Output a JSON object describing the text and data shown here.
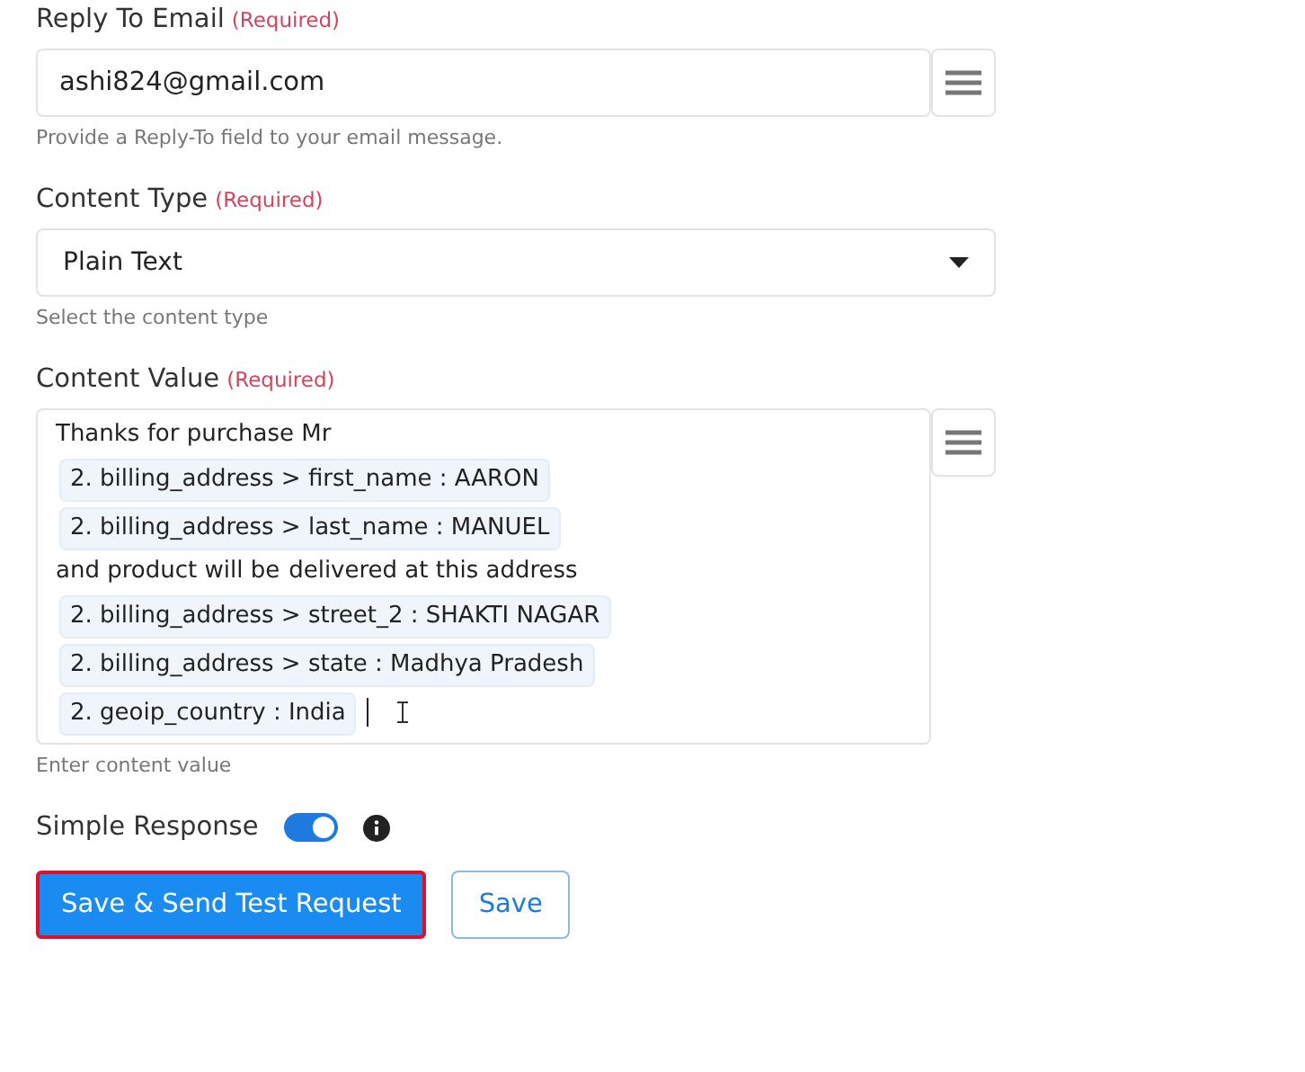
{
  "reply_to_email": {
    "label": "Reply To Email",
    "required": "(Required)",
    "value": "ashi824@gmail.com",
    "help": "Provide a Reply-To field to your email message."
  },
  "content_type": {
    "label": "Content Type",
    "required": "(Required)",
    "value": "Plain Text",
    "help": "Select the content type"
  },
  "content_value": {
    "label": "Content Value",
    "required": "(Required)",
    "help": "Enter content value",
    "segments": [
      {
        "kind": "text",
        "text": "Thanks for purchase Mr"
      },
      {
        "kind": "token",
        "text": "2. billing_address > first_name : AARON"
      },
      {
        "kind": "token",
        "text": "2. billing_address > last_name : MANUEL"
      },
      {
        "kind": "text",
        "text": "and product will be"
      },
      {
        "kind": "text",
        "text": "delivered at this address"
      },
      {
        "kind": "token",
        "text": "2. billing_address > street_2 : SHAKTI NAGAR"
      },
      {
        "kind": "token",
        "text": "2. billing_address > state : Madhya Pradesh"
      },
      {
        "kind": "token",
        "text": "2. geoip_country : India"
      }
    ]
  },
  "simple_response": {
    "label": "Simple Response",
    "on": true
  },
  "buttons": [
    {
      "kind": "primary",
      "label": "Save & Send Test Request"
    },
    {
      "kind": "outline",
      "label": "Save"
    }
  ]
}
